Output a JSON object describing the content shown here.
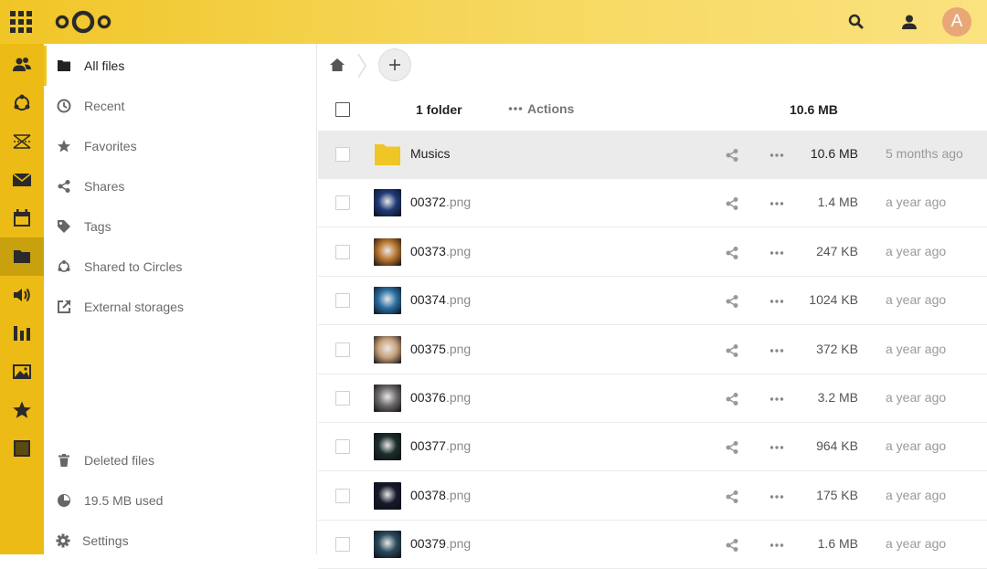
{
  "app_menu": [
    "Contacts",
    "Circles",
    "Deck",
    "Mail",
    "Calendar",
    "Files",
    "Audio Player",
    "Analytics",
    "Photos",
    "Favorites",
    "Notes"
  ],
  "header": {
    "avatar_letter": "A",
    "search_label": "Search",
    "contacts_label": "Contacts menu"
  },
  "sidebar": {
    "items": [
      {
        "label": "All files",
        "icon": "folder-icon"
      },
      {
        "label": "Recent",
        "icon": "clock-icon"
      },
      {
        "label": "Favorites",
        "icon": "star-icon"
      },
      {
        "label": "Shares",
        "icon": "share-icon"
      },
      {
        "label": "Tags",
        "icon": "tag-icon"
      },
      {
        "label": "Shared to Circles",
        "icon": "circles-icon"
      },
      {
        "label": "External storages",
        "icon": "external-icon"
      }
    ],
    "deleted_label": "Deleted files",
    "quota_label": "19.5 MB used",
    "settings_label": "Settings"
  },
  "files": {
    "summary": "1 folder",
    "actions_label": "Actions",
    "total_size": "10.6 MB",
    "rows": [
      {
        "name": "Musics",
        "ext": "",
        "size": "10.6 MB",
        "modified": "5 months ago",
        "type": "folder",
        "thumb": "#f0c526"
      },
      {
        "name": "00372",
        "ext": ".png",
        "size": "1.4 MB",
        "modified": "a year ago",
        "type": "file",
        "thumb": "#1f3a78"
      },
      {
        "name": "00373",
        "ext": ".png",
        "size": "247 KB",
        "modified": "a year ago",
        "type": "file",
        "thumb": "#b9762f"
      },
      {
        "name": "00374",
        "ext": ".png",
        "size": "1024 KB",
        "modified": "a year ago",
        "type": "file",
        "thumb": "#2b6fa3"
      },
      {
        "name": "00375",
        "ext": ".png",
        "size": "372 KB",
        "modified": "a year ago",
        "type": "file",
        "thumb": "#c9a27c"
      },
      {
        "name": "00376",
        "ext": ".png",
        "size": "3.2 MB",
        "modified": "a year ago",
        "type": "file",
        "thumb": "#6f6a6a"
      },
      {
        "name": "00377",
        "ext": ".png",
        "size": "964 KB",
        "modified": "a year ago",
        "type": "file",
        "thumb": "#1c2d2b"
      },
      {
        "name": "00378",
        "ext": ".png",
        "size": "175 KB",
        "modified": "a year ago",
        "type": "file",
        "thumb": "#151a2c"
      },
      {
        "name": "00379",
        "ext": ".png",
        "size": "1.6 MB",
        "modified": "a year ago",
        "type": "file",
        "thumb": "#2a4a5c"
      }
    ]
  },
  "colors": {
    "accent": "#f0c526",
    "appbar": "#edbb15"
  }
}
